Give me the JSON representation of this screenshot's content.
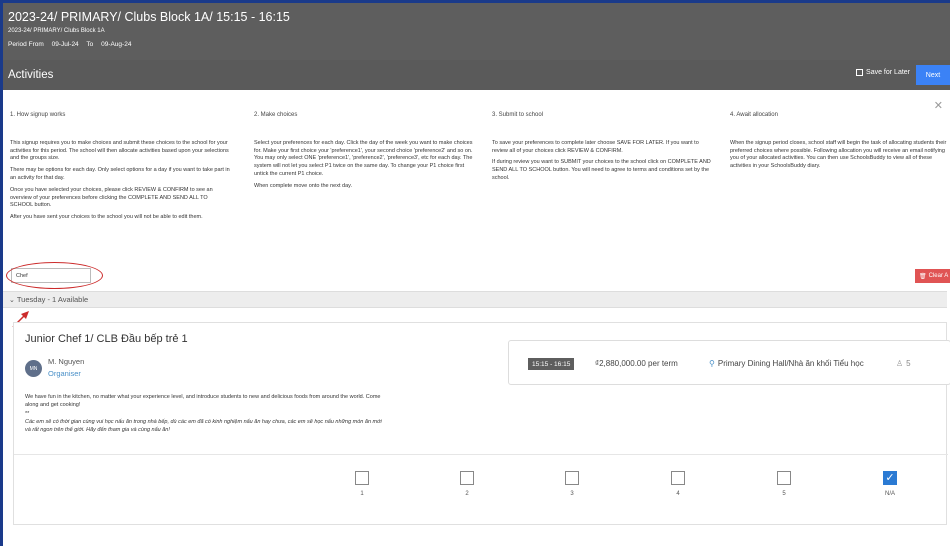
{
  "header": {
    "title": "2023-24/ PRIMARY/ Clubs Block 1A/ 15:15 - 16:15",
    "subtitle": "2023-24/ PRIMARY/ Clubs Block 1A",
    "period_from_label": "Period From",
    "period_from": "09-Jul-24",
    "period_to_label": "To",
    "period_to": "09-Aug-24"
  },
  "activities_bar": {
    "label": "Activities",
    "save_for_later": "Save for Later",
    "next": "Next"
  },
  "steps": [
    {
      "heading": "1. How signup works",
      "paragraphs": [
        "This signup requires you to make choices and submit these choices to the school for your activities for this period. The school will then allocate activities based upon your selections and the groups size.",
        "There may be options for each day. Only select options for a day if you want to take part in an activity for that day.",
        "Once you have selected your choices, please click REVIEW & CONFIRM to see an overview of your preferences before clicking the COMPLETE AND SEND ALL TO SCHOOL button.",
        "After you have sent your choices to the school you will not be able to edit them."
      ]
    },
    {
      "heading": "2. Make choices",
      "paragraphs": [
        "Select your preferences for each day. Click the day of the week you want to make choices for. Make your first choice your 'preference1', your second choice 'preference2' and so on. You may only select ONE 'preference1', 'preference2', 'preference3', etc for each day. The system will not let you select P1 twice on the same day. To change your P1 choice first untick the current P1 choice.",
        "When complete move onto the next day."
      ]
    },
    {
      "heading": "3. Submit to school",
      "paragraphs": [
        "To save your preferences to complete later choose SAVE FOR LATER. If you want to review all of your choices click REVIEW & CONFIRM.",
        "If during review you want to SUBMIT your choices to the school click on COMPLETE AND SEND ALL TO SCHOOL button. You will need to agree to terms and conditions set by the school."
      ]
    },
    {
      "heading": "4. Await allocation",
      "paragraphs": [
        "When the signup period closes, school staff will begin the task of allocating students their preferred choices where possible. Following allocation you will receive an email notifying you of your allocated activities. You can then use SchoolsBuddy to view all of these activities in your SchoolsBuddy diary."
      ]
    }
  ],
  "filter": {
    "value": "Chef",
    "clear_label": "Clear A"
  },
  "day": {
    "label": "Tuesday - 1 Available"
  },
  "activity": {
    "name": "Junior Chef 1/ CLB Đầu bếp trẻ 1",
    "organiser_initials": "MN",
    "organiser_name": "M. Nguyen",
    "organiser_role": "Organiser",
    "time": "15:15 - 16:15",
    "price": "₫2,880,000.00 per term",
    "location": "Primary Dining Hall/Nhà ăn khối Tiểu học",
    "capacity": "5",
    "description_en": "We have fun in the kitchen, no matter what your experience level, and introduce students to new and delicious foods from around the world. Come along and get cooking!",
    "description_sep": "**",
    "description_vi": "Các em sẽ có thời gian cùng vui học nấu ăn trong nhà bếp, dù các em đã có kinh nghiệm nấu ăn hay chưa, các em sẽ học nấu những món ăn mới và rất ngon trên thế giới. Hãy đến tham gia và cùng nấu ăn!"
  },
  "choices": [
    {
      "label": "1",
      "checked": false
    },
    {
      "label": "2",
      "checked": false
    },
    {
      "label": "3",
      "checked": false
    },
    {
      "label": "4",
      "checked": false
    },
    {
      "label": "5",
      "checked": false
    },
    {
      "label": "N/A",
      "checked": true
    }
  ],
  "colors": {
    "header_bg": "#5e5e5e",
    "next_button": "#3b82f6",
    "clear_button": "#e05454",
    "annotation": "#cc2b2b",
    "checkbox_checked": "#2b7ad3"
  }
}
